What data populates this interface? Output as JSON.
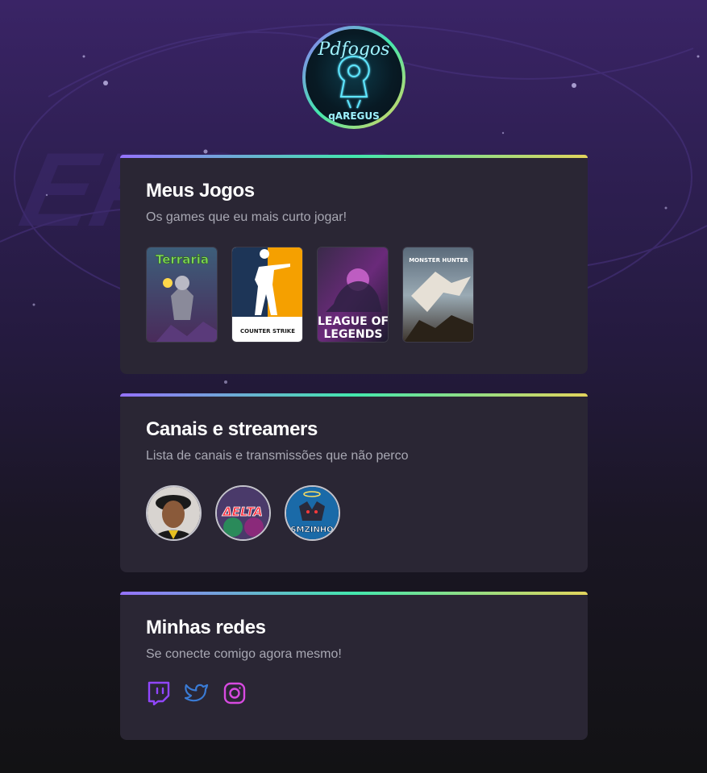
{
  "profile": {
    "logo_name": "avatar-logo",
    "logo_text_top": "Pdfogos",
    "logo_text_bottom": "qAREGUS"
  },
  "sections": {
    "games": {
      "title": "Meus Jogos",
      "subtitle": "Os games que eu mais curto jogar!",
      "items": [
        {
          "name": "Terraria",
          "logo_text": "Terraria"
        },
        {
          "name": "Counter-Strike",
          "logo_text": "COUNTER STRIKE"
        },
        {
          "name": "League of Legends",
          "logo_text_1": "LEAGUE OF",
          "logo_text_2": "LEGENDS"
        },
        {
          "name": "Monster Hunter",
          "logo_text": "MONSTER HUNTER"
        }
      ]
    },
    "streamers": {
      "title": "Canais e streamers",
      "subtitle": "Lista de canais e transmissões que não perco",
      "items": [
        {
          "name": "streamer-1"
        },
        {
          "name": "streamer-delta",
          "logo_text": "ΔELTA"
        },
        {
          "name": "streamer-smzinho",
          "logo_text": "SMZINHO"
        }
      ]
    },
    "socials": {
      "title": "Minhas redes",
      "subtitle": "Se conecte comigo agora mesmo!",
      "items": [
        {
          "icon": "twitch-icon",
          "color": "#9146ff"
        },
        {
          "icon": "twitter-icon",
          "color": "#3a7bd5"
        },
        {
          "icon": "instagram-icon",
          "color": "#d74ae0"
        }
      ]
    }
  },
  "colors": {
    "gradient_start": "#9572fc",
    "gradient_mid": "#43e7ad",
    "gradient_end": "#e2d45c",
    "card_bg": "#2a2634"
  }
}
